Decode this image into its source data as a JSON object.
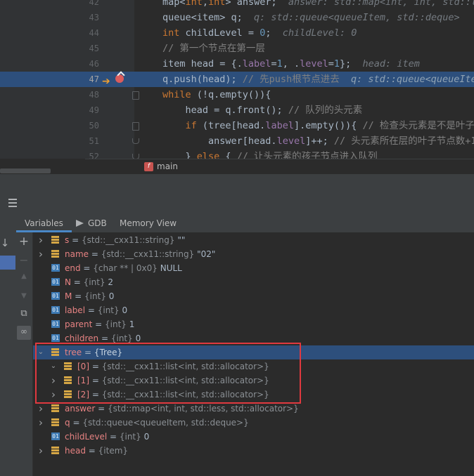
{
  "editor": {
    "lines": [
      {
        "n": "42",
        "tokens": [
          [
            "",
            "map<"
          ],
          [
            "ty",
            "int"
          ],
          [
            "",
            ","
          ],
          [
            "ty",
            "int"
          ],
          [
            "",
            "> answer;  "
          ],
          [
            "inl",
            "answer: std::map<int, int, std::l"
          ]
        ]
      },
      {
        "n": "43",
        "tokens": [
          [
            "",
            "queue<item> q;  "
          ],
          [
            "inl",
            "q: std::queue<queueItem, std::deque>"
          ]
        ]
      },
      {
        "n": "44",
        "tokens": [
          [
            "ty",
            "int"
          ],
          [
            "",
            " childLevel = "
          ],
          [
            "num",
            "0"
          ],
          [
            "",
            ";  "
          ],
          [
            "inl",
            "childLevel: 0"
          ]
        ]
      },
      {
        "n": "45",
        "tokens": [
          [
            "cm",
            "// 第一个节点在第一层"
          ]
        ]
      },
      {
        "n": "46",
        "tokens": [
          [
            "",
            "item head = {."
          ],
          [
            "fld",
            "label"
          ],
          [
            "",
            "="
          ],
          [
            "num",
            "1"
          ],
          [
            "",
            ", ."
          ],
          [
            "fld",
            "level"
          ],
          [
            "",
            "="
          ],
          [
            "num",
            "1"
          ],
          [
            "",
            "};  "
          ],
          [
            "inl",
            "head: item"
          ]
        ]
      },
      {
        "n": "47",
        "tokens": [
          [
            "",
            "q.push(head); "
          ],
          [
            "cm",
            "// 先push根节点进去  "
          ],
          [
            "inl-val",
            "q: std::queue<queueIte"
          ]
        ]
      },
      {
        "n": "48",
        "tokens": [
          [
            "kw",
            "while"
          ],
          [
            "",
            " (!q.empty()){"
          ]
        ]
      },
      {
        "n": "49",
        "tokens": [
          [
            "",
            "    head = q.front(); "
          ],
          [
            "cm",
            "// 队列的头元素"
          ]
        ]
      },
      {
        "n": "50",
        "tokens": [
          [
            "kw",
            "    if"
          ],
          [
            "",
            " (tree[head."
          ],
          [
            "fld",
            "label"
          ],
          [
            "",
            "].empty()){ "
          ],
          [
            "cm",
            "// 检查头元素是不是叶子节"
          ]
        ]
      },
      {
        "n": "51",
        "tokens": [
          [
            "",
            "        answer[head."
          ],
          [
            "fld",
            "level"
          ],
          [
            "",
            "]++; "
          ],
          [
            "cm",
            "// 头元素所在层的叶子节点数+1"
          ]
        ]
      },
      {
        "n": "52",
        "tokens": [
          [
            "",
            "    } "
          ],
          [
            "kw",
            "else"
          ],
          [
            "",
            " { "
          ],
          [
            "cm",
            "// 让头元素的孩子节点进入队列"
          ]
        ]
      }
    ],
    "breadcrumb": {
      "icon_letter": "f",
      "text": "main"
    }
  },
  "debug": {
    "tabs": {
      "variables": "Variables",
      "gdb": "GDB",
      "memory": "Memory View"
    }
  },
  "variables": [
    {
      "indent": 0,
      "expand": "collapsed",
      "icon": "obj",
      "name": "s",
      "type": "{std::__cxx11::string}",
      "value": " \"\""
    },
    {
      "indent": 0,
      "expand": "collapsed",
      "icon": "obj",
      "name": "name",
      "type": "{std::__cxx11::string}",
      "value": " \"02\""
    },
    {
      "indent": 0,
      "expand": "none",
      "icon": "01",
      "name": "end",
      "type": "{char ** | 0x0}",
      "value": " NULL"
    },
    {
      "indent": 0,
      "expand": "none",
      "icon": "01",
      "name": "N",
      "type": "{int}",
      "value": " 2"
    },
    {
      "indent": 0,
      "expand": "none",
      "icon": "01",
      "name": "M",
      "type": "{int}",
      "value": " 0"
    },
    {
      "indent": 0,
      "expand": "none",
      "icon": "01",
      "name": "label",
      "type": "{int}",
      "value": " 0"
    },
    {
      "indent": 0,
      "expand": "none",
      "icon": "01",
      "name": "parent",
      "type": "{int}",
      "value": " 1"
    },
    {
      "indent": 0,
      "expand": "none",
      "icon": "01",
      "name": "children",
      "type": "{int}",
      "value": " 0"
    },
    {
      "indent": 0,
      "expand": "expanded",
      "icon": "obj",
      "name": "tree",
      "type": "{Tree}",
      "value": "",
      "selected": true
    },
    {
      "indent": 1,
      "expand": "expanded",
      "icon": "obj",
      "name": "[0]",
      "type": "{std::__cxx11::list<int, std::allocator>}",
      "value": ""
    },
    {
      "indent": 1,
      "expand": "collapsed",
      "icon": "obj",
      "name": "[1]",
      "type": "{std::__cxx11::list<int, std::allocator>}",
      "value": ""
    },
    {
      "indent": 1,
      "expand": "collapsed",
      "icon": "obj",
      "name": "[2]",
      "type": "{std::__cxx11::list<int, std::allocator>}",
      "value": ""
    },
    {
      "indent": 0,
      "expand": "collapsed",
      "icon": "obj",
      "name": "answer",
      "type": "{std::map<int, int, std::less, std::allocator>}",
      "value": ""
    },
    {
      "indent": 0,
      "expand": "collapsed",
      "icon": "obj",
      "name": "q",
      "type": "{std::queue<queueItem, std::deque>}",
      "value": ""
    },
    {
      "indent": 0,
      "expand": "none",
      "icon": "01",
      "name": "childLevel",
      "type": "{int}",
      "value": " 0"
    },
    {
      "indent": 0,
      "expand": "collapsed",
      "icon": "obj",
      "name": "head",
      "type": "{item}",
      "value": ""
    }
  ],
  "colors": {
    "accent": "#4a88c7",
    "selection": "#2d4f7c",
    "highlight_box": "#e0393f",
    "var_name": "#e68282"
  }
}
